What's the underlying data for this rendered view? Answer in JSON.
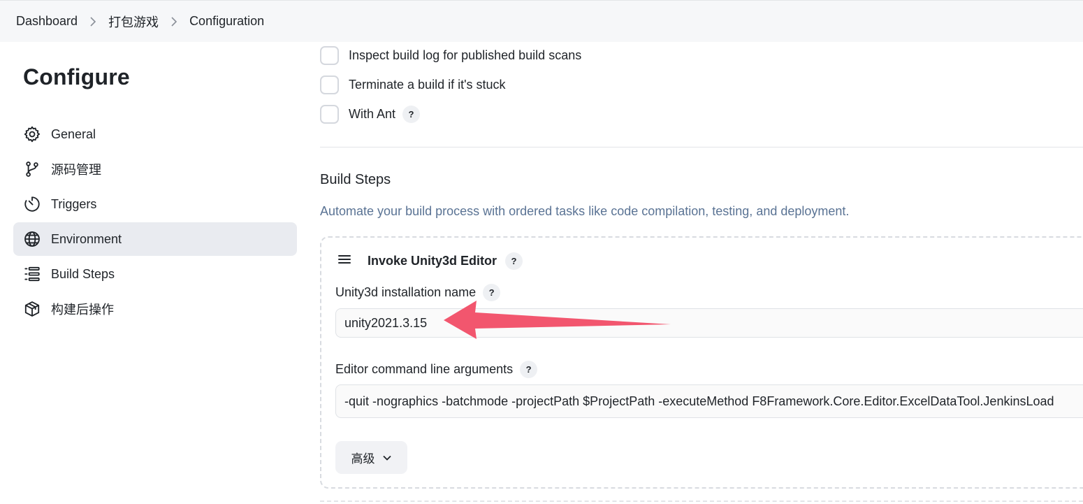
{
  "breadcrumb": {
    "items": [
      "Dashboard",
      "打包游戏",
      "Configuration"
    ]
  },
  "sidebar": {
    "title": "Configure",
    "items": [
      {
        "label": "General",
        "icon": "gear-icon"
      },
      {
        "label": "源码管理",
        "icon": "branch-icon"
      },
      {
        "label": "Triggers",
        "icon": "timer-icon"
      },
      {
        "label": "Environment",
        "icon": "globe-icon",
        "active": true
      },
      {
        "label": "Build Steps",
        "icon": "list-icon"
      },
      {
        "label": "构建后操作",
        "icon": "package-icon"
      }
    ]
  },
  "options": {
    "inspect_log": "Inspect build log for published build scans",
    "terminate_stuck": "Terminate a build if it's stuck",
    "with_ant": "With Ant"
  },
  "build_steps": {
    "title": "Build Steps",
    "description": "Automate your build process with ordered tasks like code compilation, testing, and deployment.",
    "step": {
      "title": "Invoke Unity3d Editor",
      "install_label": "Unity3d installation name",
      "install_value": "unity2021.3.15",
      "args_label": "Editor command line arguments",
      "args_value": "-quit -nographics -batchmode -projectPath $ProjectPath -executeMethod F8Framework.Core.Editor.ExcelDataTool.JenkinsLoad",
      "advanced_label": "高级"
    }
  },
  "help_glyph": "?",
  "colors": {
    "accent_desc": "#5a7394",
    "active_nav": "#e9ebf0",
    "annotation_arrow": "#f2566e"
  }
}
